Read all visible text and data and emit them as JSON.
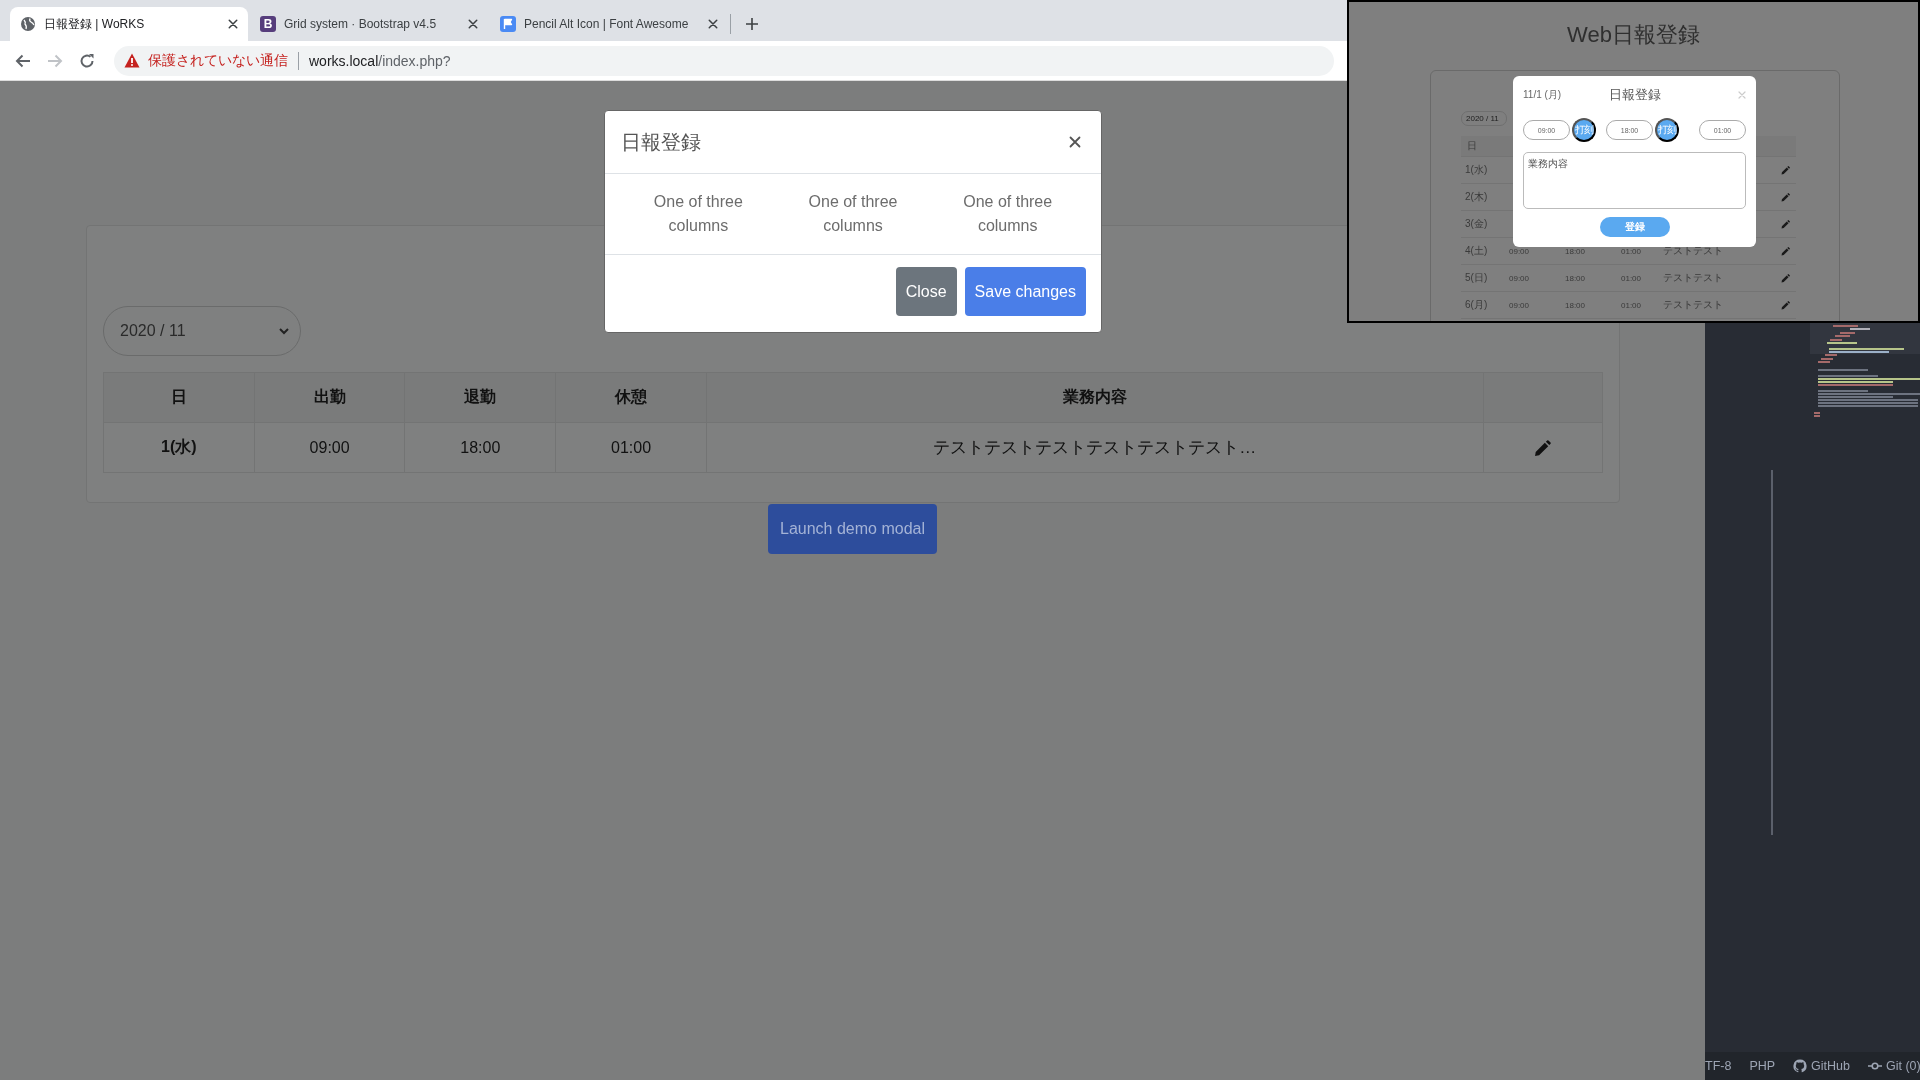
{
  "browser": {
    "tabs": [
      {
        "title": "日報登録 | WoRKS",
        "selected": true
      },
      {
        "title": "Grid system · Bootstrap v4.5",
        "selected": false,
        "logo_letter": "B"
      },
      {
        "title": "Pencil Alt Icon | Font Awesome",
        "selected": false
      }
    ],
    "back": {
      "disabled": false
    },
    "forward": {
      "disabled": true
    },
    "address": {
      "warning": "保護されていない通信",
      "host": "works.local",
      "path": "/index.php?"
    }
  },
  "page": {
    "month_select": "2020 / 11",
    "table": {
      "columns": [
        "日",
        "出勤",
        "退勤",
        "休憩",
        "業務内容"
      ],
      "rows": [
        {
          "day": "1(水)",
          "start": "09:00",
          "end": "18:00",
          "break": "01:00",
          "content": "テストテストテストテストテストテスト…"
        }
      ]
    },
    "launch_button": "Launch demo modal"
  },
  "modal": {
    "title": "日報登録",
    "columns": [
      "One of three columns",
      "One of three columns",
      "One of three columns"
    ],
    "buttons": [
      {
        "label": "Close",
        "kind": "secondary"
      },
      {
        "label": "Save changes",
        "kind": "primary"
      }
    ]
  },
  "preview": {
    "title": "Web日報登録",
    "month_select": "2020 / 11",
    "table_header": "日",
    "rows": [
      {
        "day": "1(水)"
      },
      {
        "day": "2(木)"
      },
      {
        "day": "3(金)"
      },
      {
        "day": "4(土)",
        "start": "09:00",
        "end": "18:00",
        "break": "01:00",
        "content": "テストテスト"
      },
      {
        "day": "5(日)",
        "start": "09:00",
        "end": "18:00",
        "break": "01:00",
        "content": "テストテスト"
      },
      {
        "day": "6(月)",
        "start": "09:00",
        "end": "18:00",
        "break": "01:00",
        "content": "テストテスト"
      }
    ],
    "modal": {
      "date": "11/1 (月)",
      "title": "日報登録",
      "times": [
        {
          "value": "09:00",
          "stamp": "打刻"
        },
        {
          "value": "18:00",
          "stamp": "打刻"
        },
        {
          "value": "01:00"
        }
      ],
      "placeholder": "業務内容",
      "submit": "登録"
    }
  },
  "editor": {
    "status_bar": [
      {
        "label": "TF-8"
      },
      {
        "label": "PHP"
      },
      {
        "label": "GitHub"
      },
      {
        "label": "Git (0)"
      }
    ]
  }
}
